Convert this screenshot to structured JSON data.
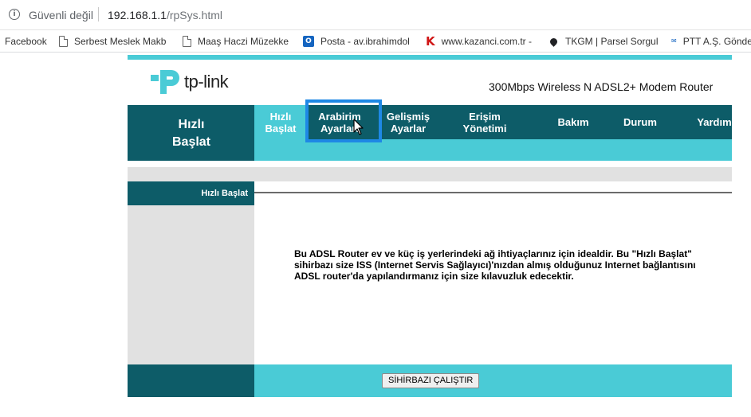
{
  "browser": {
    "security_label": "Güvenli değil",
    "url_host": "192.168.1.1",
    "url_path": "/rpSys.html",
    "bookmarks": [
      {
        "label": "Facebook",
        "icon": "none"
      },
      {
        "label": "Serbest Meslek Makb",
        "icon": "document-icon"
      },
      {
        "label": "Maaş Haczi Müzekke",
        "icon": "document-icon"
      },
      {
        "label": "Posta - av.ibrahimdol",
        "icon": "outlook-icon"
      },
      {
        "label": "www.kazanci.com.tr -",
        "icon": "kazanci-icon"
      },
      {
        "label": "TKGM | Parsel Sorgul",
        "icon": "location-pin-icon"
      },
      {
        "label": "PTT A.Ş. Gönde",
        "icon": "ptt-icon"
      }
    ]
  },
  "router": {
    "brand": "tp-link",
    "model": "300Mbps Wireless N ADSL2+ Modem Router",
    "nav": {
      "section_title": "Hızlı Başlat",
      "items": [
        {
          "line1": "Hızlı",
          "line2": "Başlat",
          "active": true
        },
        {
          "line1": "Arabirim",
          "line2": "Ayarları"
        },
        {
          "line1": "Gelişmiş",
          "line2": "Ayarlar"
        },
        {
          "line1": "Erişim",
          "line2": "Yönetimi"
        },
        {
          "line1": "Bakım"
        },
        {
          "line1": "Durum"
        },
        {
          "line1": "Yardım"
        }
      ]
    },
    "sidebar_title": "Hızlı Başlat",
    "description": "Bu ADSL Router ev ve küç iş yerlerindeki ağ ihtiyaçlarınız için idealdir. Bu \"Hızlı Başlat\" sihirbazı size ISS (Internet Servis Sağlayıcı)'nızdan almış olduğunuz Internet bağlantısını ADSL router'da yapılandırmanız için size kılavuzluk edecektir.",
    "run_button": "SİHİRBAZI ÇALIŞTIR",
    "colors": {
      "dark_teal": "#0d5c68",
      "light_teal": "#4acbd6",
      "highlight": "#1e88e5"
    }
  }
}
